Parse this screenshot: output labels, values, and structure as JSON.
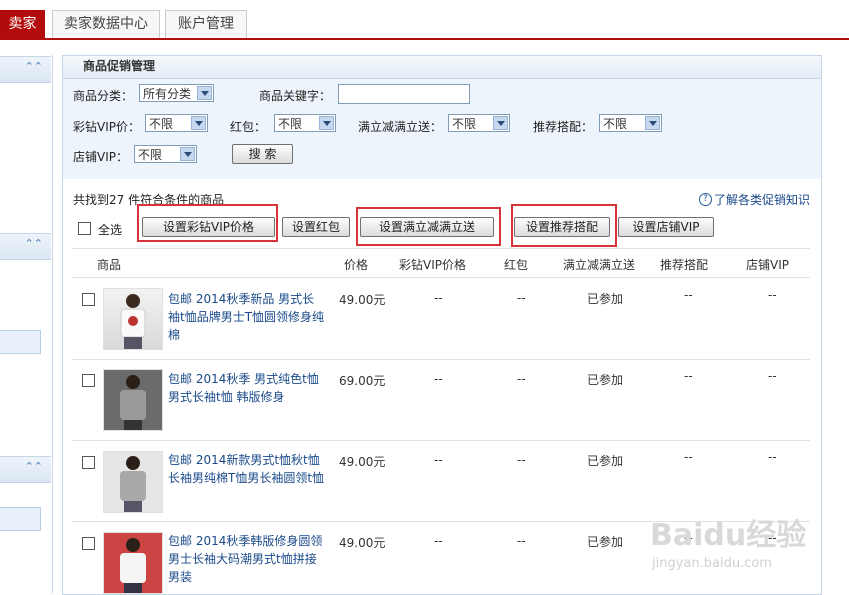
{
  "nav": {
    "tabs": [
      "卖家",
      "卖家数据中心",
      "账户管理"
    ]
  },
  "panel": {
    "title": "商品促销管理",
    "filters": {
      "category_label": "商品分类：",
      "category_value": "所有分类",
      "keyword_label": "商品关键字：",
      "keyword_value": "",
      "vip_label": "彩钻VIP价：",
      "vip_value": "不限",
      "hongbao_label": "红包：",
      "hongbao_value": "不限",
      "manjian_label": "满立减满立送：",
      "manjian_value": "不限",
      "tuijian_label": "推荐搭配：",
      "tuijian_value": "不限",
      "shop_vip_label": "店铺VIP：",
      "shop_vip_value": "不限",
      "search_button": "搜 索"
    },
    "result_text": "共找到27 件符合条件的商品",
    "help_link": "了解各类促销知识",
    "help_icon": "?",
    "select_all": "全选",
    "actions": [
      "设置彩钻VIP价格",
      "设置红包",
      "设置满立减满立送",
      "设置推荐搭配",
      "设置店铺VIP"
    ],
    "columns": [
      "商品",
      "价格",
      "彩钻VIP价格",
      "红包",
      "满立减满立送",
      "推荐搭配",
      "店铺VIP"
    ],
    "rows": [
      {
        "name": "包邮 2014秋季新品 男式长袖t恤品牌男士T恤圆领修身纯棉",
        "price": "49.00元",
        "vip": "--",
        "hongbao": "--",
        "manjian": "已参加",
        "tuijian": "--",
        "shopvip": "--"
      },
      {
        "name": "包邮 2014秋季 男式纯色t恤男式长袖t恤 韩版修身",
        "price": "69.00元",
        "vip": "--",
        "hongbao": "--",
        "manjian": "已参加",
        "tuijian": "--",
        "shopvip": "--"
      },
      {
        "name": "包邮 2014新款男式t恤秋t恤长袖男纯棉T恤男长袖圆领t恤",
        "price": "49.00元",
        "vip": "--",
        "hongbao": "--",
        "manjian": "已参加",
        "tuijian": "--",
        "shopvip": "--"
      },
      {
        "name": "包邮 2014秋季韩版修身圆领男士长袖大码潮男式t恤拼接男装",
        "price": "49.00元",
        "vip": "--",
        "hongbao": "--",
        "manjian": "已参加",
        "tuijian": "--",
        "shopvip": "--"
      }
    ]
  },
  "watermark": {
    "brand": "Baidu经验",
    "url": "jingyan.baidu.com"
  },
  "colors": {
    "accent_red": "#b30b0b",
    "link_blue": "#1a4a8a",
    "highlight_box": "#d7333a"
  }
}
